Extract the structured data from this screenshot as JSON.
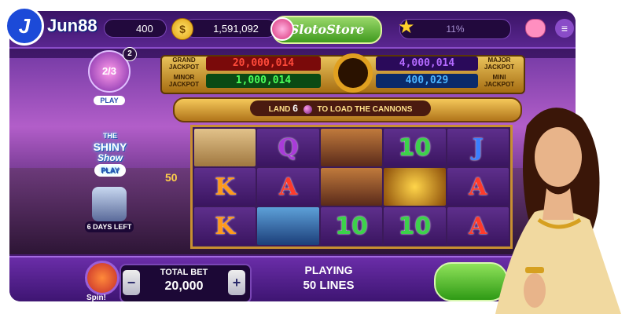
{
  "brand": {
    "logo_letter": "J",
    "logo_text": "Jun88"
  },
  "topbar": {
    "gems": "400",
    "coin_icon": "$",
    "coins": "1,591,092",
    "store": "SlotoStore",
    "xp": "11%",
    "menu_icon": "≡"
  },
  "jackpots": {
    "grand": {
      "label": "GRAND JACKPOT",
      "value": "20,000,014"
    },
    "major": {
      "label": "MAJOR JACKPOT",
      "value": "4,000,014"
    },
    "minor": {
      "label": "MINOR JACKPOT",
      "value": "1,000,014"
    },
    "mini": {
      "label": "MINI JACKPOT",
      "value": "400,029"
    }
  },
  "cannon": {
    "prefix": "LAND",
    "count": "6",
    "suffix": "TO LOAD THE CANNONS"
  },
  "side": {
    "mission_progress": "2/3",
    "mission_badge": "2",
    "mission_play": "PLAY",
    "shiny_title_1": "THE",
    "shiny_title_2": "SHINY",
    "shiny_title_3": "Show",
    "shiny_play": "PLAY",
    "days_left": "6 DAYS LEFT",
    "line_number": "50"
  },
  "reels": [
    [
      "map",
      "Q",
      "pirate-woman",
      "10",
      "J"
    ],
    [
      "K",
      "A",
      "pirate-captain",
      "treasure-chest",
      "A"
    ],
    [
      "K",
      "ship",
      "10",
      "10",
      "A"
    ]
  ],
  "bottom": {
    "spin_label": "Spin!",
    "minus": "−",
    "plus": "+",
    "total_bet_label": "TOTAL BET",
    "total_bet": "20,000",
    "playing_label": "PLAYING",
    "lines": "50 LINES"
  },
  "colors": {
    "accent": "#6b2a9c",
    "gold": "#e0a020",
    "green": "#3cd24a"
  }
}
